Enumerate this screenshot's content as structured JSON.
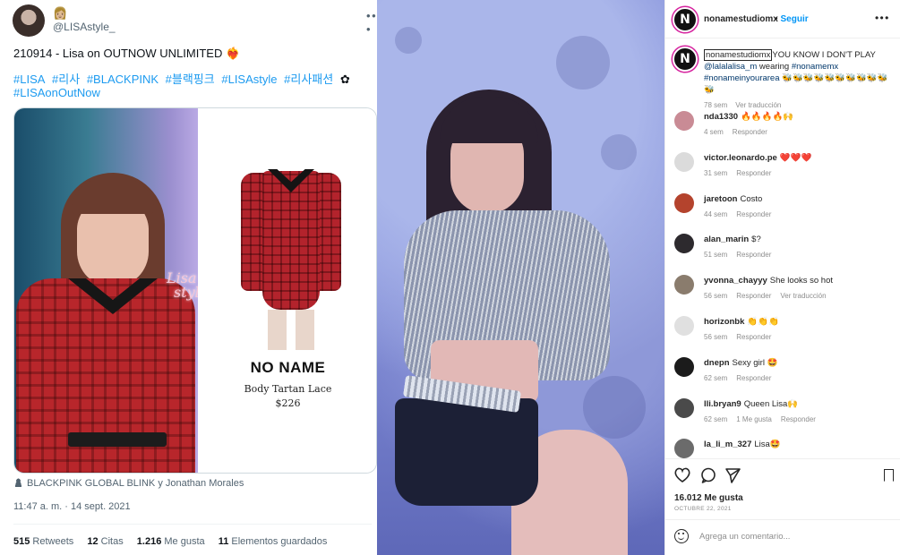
{
  "tweet": {
    "emoji": "👩🏼",
    "handle": "@LISAstyle_",
    "text": "210914 - Lisa on OUTNOW UNLIMITED ❤️‍🔥",
    "hashtags": [
      "#LISA",
      "#리사",
      "#BLACKPINK",
      "#블랙핑크",
      "#LISAstyle",
      "#리사패션"
    ],
    "hashtag_trail": "✿",
    "hashtag_last": "#LISAonOutNow",
    "card": {
      "watermark_line1": "Lisa",
      "watermark_line2": "style",
      "brand": "NO NAME",
      "product": "Body Tartan Lace",
      "price": "$226"
    },
    "tagged": "BLACKPINK GLOBAL BLINK y Jonathan Morales",
    "timestamp": "11:47 a. m. · 14 sept. 2021",
    "stats": {
      "retweets_count": "515",
      "retweets_label": "Retweets",
      "quotes_count": "12",
      "quotes_label": "Citas",
      "likes_count": "1.216",
      "likes_label": "Me gusta",
      "saves_count": "11",
      "saves_label": "Elementos guardados"
    },
    "more_icon": "ellipsis-icon"
  },
  "instagram": {
    "account": "nonamestudiomx",
    "avatar_letter": "N",
    "follow_label": "Seguir",
    "follow_dot": "•",
    "caption": {
      "username": "nonamestudiomx",
      "text": "YOU KNOW I DON'T PLAY",
      "mention": "@lalalalisa_m",
      "wearing": "wearing",
      "tag1": "#nonamemx",
      "tag2": "#nonameinyourarea",
      "emojis": "🐝🐝🐝🐝🐝🐝🐝🐝🐝🐝🐝",
      "age": "78 sem",
      "translate": "Ver traducción"
    },
    "comments": [
      {
        "user": "nda1330",
        "text": "🔥🔥🔥🔥🙌",
        "age": "4 sem",
        "likes": "",
        "reply": "Responder",
        "translate": "",
        "avatar": "#c98b95"
      },
      {
        "user": "victor.leonardo.pe",
        "text": "❤️❤️❤️",
        "age": "31 sem",
        "likes": "",
        "reply": "Responder",
        "translate": "",
        "avatar": "#dbdbdb"
      },
      {
        "user": "jaretoon",
        "text": "Costo",
        "age": "44 sem",
        "likes": "",
        "reply": "Responder",
        "translate": "",
        "avatar": "#b4432d"
      },
      {
        "user": "alan_marin",
        "text": "$?",
        "age": "51 sem",
        "likes": "",
        "reply": "Responder",
        "translate": "",
        "avatar": "#2d2a2e"
      },
      {
        "user": "yvonna_chayyy",
        "text": "She looks so hot",
        "age": "56 sem",
        "likes": "",
        "reply": "Responder",
        "translate": "Ver traducción",
        "avatar": "#8a7c6d"
      },
      {
        "user": "horizonbk",
        "text": "👏👏👏",
        "age": "56 sem",
        "likes": "",
        "reply": "Responder",
        "translate": "",
        "avatar": "#e0e0e0"
      },
      {
        "user": "dnepn",
        "text": "Sexy girl 🤩",
        "age": "62 sem",
        "likes": "",
        "reply": "Responder",
        "translate": "",
        "avatar": "#1b1b1b"
      },
      {
        "user": "lli.bryan9",
        "text": "Queen Lisa🙌",
        "age": "62 sem",
        "likes": "1 Me gusta",
        "reply": "Responder",
        "translate": "",
        "avatar": "#4a4a4a"
      },
      {
        "user": "la_li_m_327",
        "text": "Lisa🤩",
        "age": "",
        "likes": "",
        "reply": "",
        "translate": "",
        "avatar": "#6b6b6b"
      }
    ],
    "likes_total": "16.012 Me gusta",
    "date": "OCTUBRE 22, 2021",
    "add_comment_placeholder": "Agrega un comentario..."
  },
  "colors": {
    "twitter_blue": "#1d9bf0",
    "ig_blue": "#0095f6",
    "ig_gray": "#8e8e8e"
  }
}
